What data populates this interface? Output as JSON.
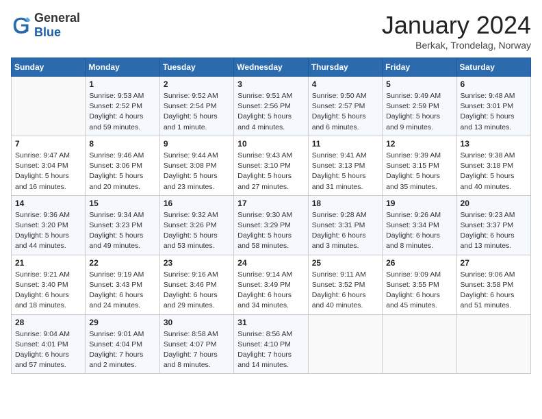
{
  "header": {
    "logo_general": "General",
    "logo_blue": "Blue",
    "month_title": "January 2024",
    "location": "Berkak, Trondelag, Norway"
  },
  "days_of_week": [
    "Sunday",
    "Monday",
    "Tuesday",
    "Wednesday",
    "Thursday",
    "Friday",
    "Saturday"
  ],
  "weeks": [
    [
      {
        "num": "",
        "info": ""
      },
      {
        "num": "1",
        "info": "Sunrise: 9:53 AM\nSunset: 2:52 PM\nDaylight: 4 hours\nand 59 minutes."
      },
      {
        "num": "2",
        "info": "Sunrise: 9:52 AM\nSunset: 2:54 PM\nDaylight: 5 hours\nand 1 minute."
      },
      {
        "num": "3",
        "info": "Sunrise: 9:51 AM\nSunset: 2:56 PM\nDaylight: 5 hours\nand 4 minutes."
      },
      {
        "num": "4",
        "info": "Sunrise: 9:50 AM\nSunset: 2:57 PM\nDaylight: 5 hours\nand 6 minutes."
      },
      {
        "num": "5",
        "info": "Sunrise: 9:49 AM\nSunset: 2:59 PM\nDaylight: 5 hours\nand 9 minutes."
      },
      {
        "num": "6",
        "info": "Sunrise: 9:48 AM\nSunset: 3:01 PM\nDaylight: 5 hours\nand 13 minutes."
      }
    ],
    [
      {
        "num": "7",
        "info": "Sunrise: 9:47 AM\nSunset: 3:04 PM\nDaylight: 5 hours\nand 16 minutes."
      },
      {
        "num": "8",
        "info": "Sunrise: 9:46 AM\nSunset: 3:06 PM\nDaylight: 5 hours\nand 20 minutes."
      },
      {
        "num": "9",
        "info": "Sunrise: 9:44 AM\nSunset: 3:08 PM\nDaylight: 5 hours\nand 23 minutes."
      },
      {
        "num": "10",
        "info": "Sunrise: 9:43 AM\nSunset: 3:10 PM\nDaylight: 5 hours\nand 27 minutes."
      },
      {
        "num": "11",
        "info": "Sunrise: 9:41 AM\nSunset: 3:13 PM\nDaylight: 5 hours\nand 31 minutes."
      },
      {
        "num": "12",
        "info": "Sunrise: 9:39 AM\nSunset: 3:15 PM\nDaylight: 5 hours\nand 35 minutes."
      },
      {
        "num": "13",
        "info": "Sunrise: 9:38 AM\nSunset: 3:18 PM\nDaylight: 5 hours\nand 40 minutes."
      }
    ],
    [
      {
        "num": "14",
        "info": "Sunrise: 9:36 AM\nSunset: 3:20 PM\nDaylight: 5 hours\nand 44 minutes."
      },
      {
        "num": "15",
        "info": "Sunrise: 9:34 AM\nSunset: 3:23 PM\nDaylight: 5 hours\nand 49 minutes."
      },
      {
        "num": "16",
        "info": "Sunrise: 9:32 AM\nSunset: 3:26 PM\nDaylight: 5 hours\nand 53 minutes."
      },
      {
        "num": "17",
        "info": "Sunrise: 9:30 AM\nSunset: 3:29 PM\nDaylight: 5 hours\nand 58 minutes."
      },
      {
        "num": "18",
        "info": "Sunrise: 9:28 AM\nSunset: 3:31 PM\nDaylight: 6 hours\nand 3 minutes."
      },
      {
        "num": "19",
        "info": "Sunrise: 9:26 AM\nSunset: 3:34 PM\nDaylight: 6 hours\nand 8 minutes."
      },
      {
        "num": "20",
        "info": "Sunrise: 9:23 AM\nSunset: 3:37 PM\nDaylight: 6 hours\nand 13 minutes."
      }
    ],
    [
      {
        "num": "21",
        "info": "Sunrise: 9:21 AM\nSunset: 3:40 PM\nDaylight: 6 hours\nand 18 minutes."
      },
      {
        "num": "22",
        "info": "Sunrise: 9:19 AM\nSunset: 3:43 PM\nDaylight: 6 hours\nand 24 minutes."
      },
      {
        "num": "23",
        "info": "Sunrise: 9:16 AM\nSunset: 3:46 PM\nDaylight: 6 hours\nand 29 minutes."
      },
      {
        "num": "24",
        "info": "Sunrise: 9:14 AM\nSunset: 3:49 PM\nDaylight: 6 hours\nand 34 minutes."
      },
      {
        "num": "25",
        "info": "Sunrise: 9:11 AM\nSunset: 3:52 PM\nDaylight: 6 hours\nand 40 minutes."
      },
      {
        "num": "26",
        "info": "Sunrise: 9:09 AM\nSunset: 3:55 PM\nDaylight: 6 hours\nand 45 minutes."
      },
      {
        "num": "27",
        "info": "Sunrise: 9:06 AM\nSunset: 3:58 PM\nDaylight: 6 hours\nand 51 minutes."
      }
    ],
    [
      {
        "num": "28",
        "info": "Sunrise: 9:04 AM\nSunset: 4:01 PM\nDaylight: 6 hours\nand 57 minutes."
      },
      {
        "num": "29",
        "info": "Sunrise: 9:01 AM\nSunset: 4:04 PM\nDaylight: 7 hours\nand 2 minutes."
      },
      {
        "num": "30",
        "info": "Sunrise: 8:58 AM\nSunset: 4:07 PM\nDaylight: 7 hours\nand 8 minutes."
      },
      {
        "num": "31",
        "info": "Sunrise: 8:56 AM\nSunset: 4:10 PM\nDaylight: 7 hours\nand 14 minutes."
      },
      {
        "num": "",
        "info": ""
      },
      {
        "num": "",
        "info": ""
      },
      {
        "num": "",
        "info": ""
      }
    ]
  ]
}
